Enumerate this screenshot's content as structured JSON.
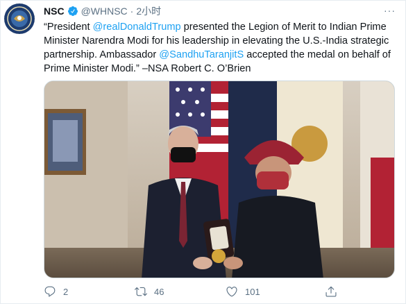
{
  "tweet": {
    "author_name": "NSC",
    "handle": "@WHNSC",
    "separator": "·",
    "time": "2小时",
    "more_label": "···",
    "text_parts": {
      "p1": "“President ",
      "mention1": "@realDonaldTrump",
      "p2": " presented the Legion of Merit to Indian Prime Minister Narendra Modi for his leadership in elevating the U.S.-India strategic partnership. Ambassador ",
      "mention2": "@SandhuTaranjitS",
      "p3": " accepted the medal on behalf of Prime Minister Modi.” –NSA Robert C. O’Brien"
    },
    "colors": {
      "link": "#1da1f2",
      "muted": "#5b7083",
      "verified": "#1da1f2"
    }
  },
  "actions": {
    "reply_count": "2",
    "retweet_count": "46",
    "like_count": "101",
    "reply_icon": "reply-icon",
    "retweet_icon": "retweet-icon",
    "like_icon": "heart-icon",
    "share_icon": "share-icon"
  }
}
